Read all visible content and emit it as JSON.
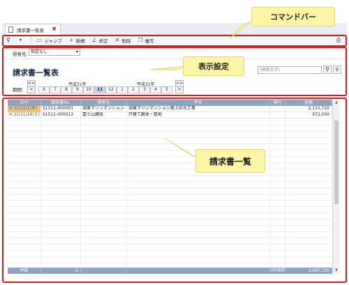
{
  "tab": {
    "title": "請求書一覧表",
    "close": "✖"
  },
  "toolbar": {
    "items": [
      {
        "icon": "search-icon",
        "label": ""
      },
      {
        "icon": "chevron-down-icon",
        "label": ""
      },
      {
        "icon": "jump-icon",
        "label": "ジャンプ"
      },
      {
        "icon": "add-icon",
        "label": "新規"
      },
      {
        "icon": "edit-icon",
        "label": "修正"
      },
      {
        "icon": "delete-icon",
        "label": "削除"
      },
      {
        "icon": "copy-icon",
        "label": "複写"
      }
    ]
  },
  "settings": {
    "customer_label": "得意先:",
    "customer_value": "指定なし",
    "page_title": "請求書一覧表",
    "search_placeholder": "(検索文字)",
    "period_label": "期間:",
    "era_left": "平成31年",
    "era_right": "平成31年",
    "months": [
      "6",
      "7",
      "8",
      "9",
      "10",
      "11",
      "12",
      "1",
      "2",
      "3",
      "4",
      "5"
    ],
    "selected_month": "11"
  },
  "grid": {
    "columns": [
      "日付",
      "請求書No.",
      "得意先",
      "件名",
      "発行",
      "金額"
    ],
    "rows": [
      {
        "date": "H.31/11/1(木)",
        "no": "S1511-000001",
        "customer": "湖東マリンマンション",
        "subject": "湖東マリンマンション屋上防水工事",
        "issued": "",
        "amount": "2,115,720"
      },
      {
        "date": "H.31/11/16(土)",
        "no": "S1511-000013",
        "customer": "富士山建設",
        "subject": "戸建て解体・整地",
        "issued": "",
        "amount": "972,000"
      }
    ],
    "footer": {
      "count_label": "件数",
      "count_value": "2",
      "total_label": "合計金額",
      "total_value": "3,087,720"
    }
  },
  "callouts": {
    "command_bar": "コマンドバー",
    "display_settings": "表示設定",
    "invoice_list": "請求書一覧"
  }
}
